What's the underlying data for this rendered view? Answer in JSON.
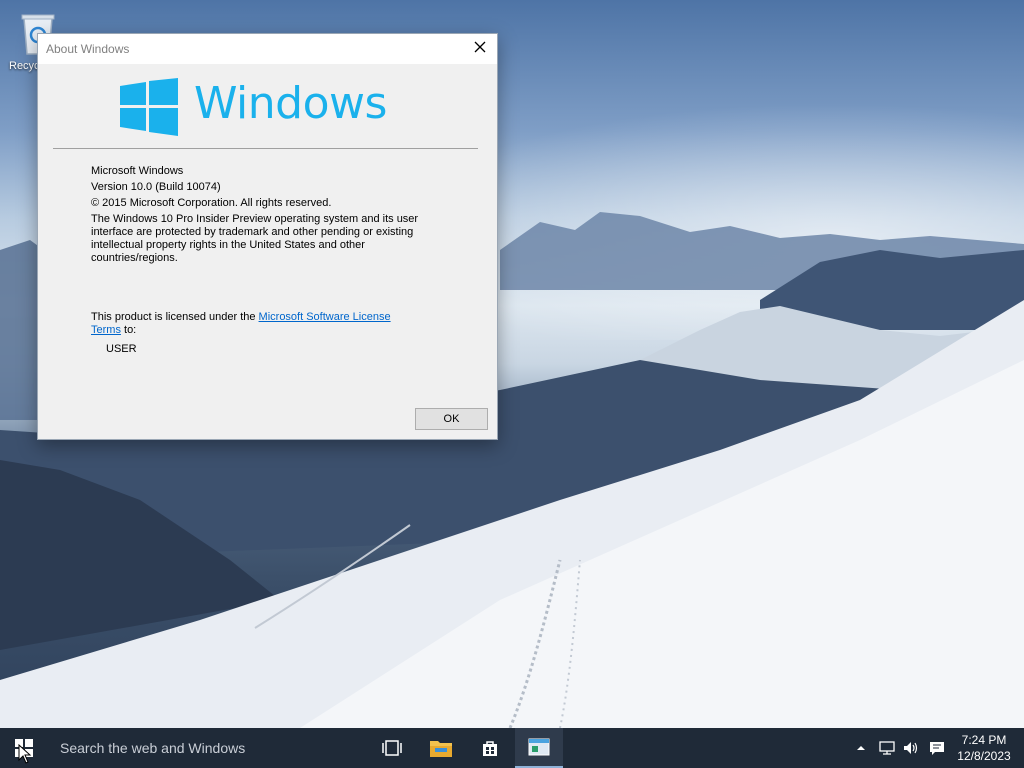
{
  "desktop": {
    "recycle_bin_label": "Recyc"
  },
  "dialog": {
    "title": "About Windows",
    "close_icon": "close-icon",
    "logo_icon": "windows-logo-icon",
    "wordmark": "Windows",
    "product_name": "Microsoft Windows",
    "version": "Version 10.0 (Build 10074)",
    "copyright": "© 2015 Microsoft Corporation. All rights reserved.",
    "legal_notice": "The Windows 10 Pro Insider Preview operating system and its user interface are protected by trademark and other pending or existing intellectual property rights in the United States and other countries/regions.",
    "license_prefix": "This product is licensed under the ",
    "license_link": "Microsoft Software License Terms",
    "license_suffix": " to:",
    "licensed_user": "USER",
    "ok_label": "OK"
  },
  "taskbar": {
    "start_icon": "windows-start-icon",
    "search_placeholder": "Search the web and Windows",
    "icons": [
      "task-view-icon",
      "file-explorer-icon",
      "store-icon",
      "app-window-icon"
    ],
    "tray_icons": [
      "chevron-up-icon",
      "network-icon",
      "volume-icon",
      "action-center-icon"
    ],
    "time": "7:24 PM",
    "date": "12/8/2023"
  },
  "colors": {
    "accent": "#1ab1ec",
    "taskbar": "#1f2a38",
    "dialog_bg": "#f0f0f0",
    "link": "#0066cc"
  }
}
